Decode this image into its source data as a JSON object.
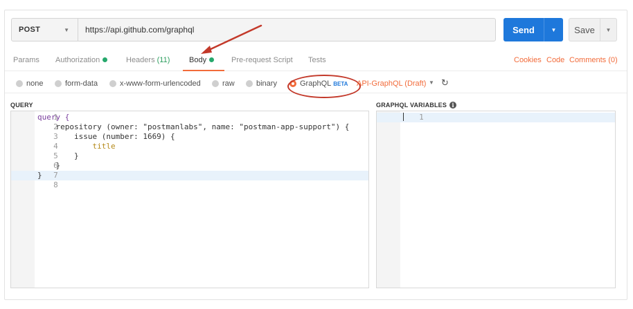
{
  "request": {
    "method": "POST",
    "url": "https://api.github.com/graphql",
    "send_label": "Send",
    "save_label": "Save"
  },
  "tabs": [
    {
      "label": "Params",
      "count": "",
      "dot": false,
      "active": false
    },
    {
      "label": "Authorization",
      "count": "",
      "dot": true,
      "active": false
    },
    {
      "label": "Headers",
      "count": "(11)",
      "dot": false,
      "active": false
    },
    {
      "label": "Body",
      "count": "",
      "dot": true,
      "active": true
    },
    {
      "label": "Pre-request Script",
      "count": "",
      "dot": false,
      "active": false
    },
    {
      "label": "Tests",
      "count": "",
      "dot": false,
      "active": false
    }
  ],
  "right_links": {
    "cookies": "Cookies",
    "code": "Code",
    "comments": "Comments (0)"
  },
  "body_types": [
    {
      "label": "none",
      "selected": false
    },
    {
      "label": "form-data",
      "selected": false
    },
    {
      "label": "x-www-form-urlencoded",
      "selected": false
    },
    {
      "label": "raw",
      "selected": false
    },
    {
      "label": "binary",
      "selected": false
    },
    {
      "label": "GraphQL",
      "selected": true
    }
  ],
  "graphql_badge": "BETA",
  "schema_label": "API-GraphQL (Draft)",
  "query_panel": {
    "label": "QUERY",
    "line_numbers": [
      "1",
      "2",
      "3",
      "4",
      "5",
      "6",
      "7",
      "8"
    ],
    "code_lines": [
      "query {",
      "    repository (owner: \"postmanlabs\", name: \"postman-app-support\") {",
      "        issue (number: 1669) {",
      "            title",
      "        }",
      "    }",
      "}",
      ""
    ]
  },
  "variables_panel": {
    "label": "GRAPHQL VARIABLES",
    "line_numbers": [
      "1"
    ]
  },
  "colors": {
    "accent": "#f26b3a",
    "send": "#1e78db",
    "dot": "#26a86c",
    "annotation": "#c3392a"
  },
  "icons": {
    "method_dropdown": "chevron-down-icon",
    "send_dropdown": "chevron-down-icon",
    "save_dropdown": "chevron-down-icon",
    "schema_dropdown": "chevron-down-icon",
    "refresh": "refresh-icon",
    "info": "info-icon"
  }
}
